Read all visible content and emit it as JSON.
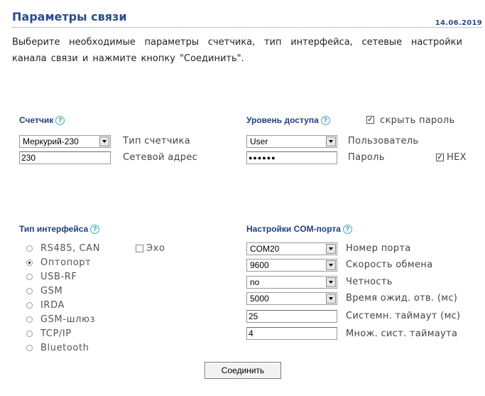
{
  "header": {
    "title": "Параметры связи",
    "date": "14.06.2019"
  },
  "intro": "Выберите необходимые параметры счетчика, тип интерфейса, сетевые настройки канала связи и нажмите кнопку \"Соединить\".",
  "help_glyph": "?",
  "meter": {
    "title": "Счетчик",
    "type_value": "Меркурий-230",
    "type_label": "Тип счетчика",
    "address_value": "230",
    "address_label": "Сетевой адрес"
  },
  "access": {
    "title": "Уровень доступа",
    "hide_password_label": "скрыть пароль",
    "hide_password_checked": true,
    "user_value": "User",
    "user_label": "Пользователь",
    "password_mask": "●●●●●●",
    "password_label": "Пароль",
    "hex_label": "HEX",
    "hex_checked": true
  },
  "interface": {
    "title": "Тип интерфейса",
    "echo_label": "Эхо",
    "echo_checked": false,
    "options": [
      "RS485, CAN",
      "Оптопорт",
      "USB-RF",
      "GSM",
      "IRDA",
      "GSM-шлюз",
      "TCP/IP",
      "Bluetooth"
    ],
    "selected_index": 1
  },
  "com": {
    "title": "Настройки COM-порта",
    "port_value": "COM20",
    "port_label": "Номер порта",
    "speed_value": "9600",
    "speed_label": "Скорость обмена",
    "parity_value": "no",
    "parity_label": "Четность",
    "timeout_value": "5000",
    "timeout_label": "Время ожид. отв. (мс)",
    "sys_timeout_value": "25",
    "sys_timeout_label": "Системн. таймаут (мс)",
    "mult_value": "4",
    "mult_label": "Множ. сист. таймаута"
  },
  "connect_label": "Соединить",
  "colors": {
    "title": "#2b4a8b",
    "section": "#1f3f7f",
    "help": "#2f8ea0"
  }
}
